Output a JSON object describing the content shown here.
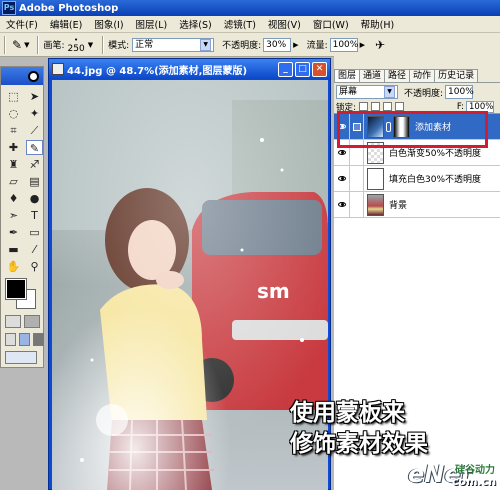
{
  "app": {
    "title": "Adobe Photoshop",
    "icon": "photoshop-icon"
  },
  "menu": [
    "文件(F)",
    "编辑(E)",
    "图象(I)",
    "图层(L)",
    "选择(S)",
    "滤镜(T)",
    "视图(V)",
    "窗口(W)",
    "帮助(H)"
  ],
  "options": {
    "brush_label": "画笔:",
    "brush_size": "250",
    "mode_label": "模式:",
    "mode_value": "正常",
    "opacity_label": "不透明度:",
    "opacity_value": "30%",
    "flow_label": "流量:",
    "flow_value": "100%"
  },
  "toolbox": {
    "tools": [
      "marquee-icon",
      "move-icon",
      "lasso-icon",
      "magic-wand-icon",
      "crop-icon",
      "slice-icon",
      "healing-brush-icon",
      "brush-icon",
      "clone-stamp-icon",
      "history-brush-icon",
      "eraser-icon",
      "gradient-icon",
      "blur-icon",
      "dodge-icon",
      "path-select-icon",
      "type-icon",
      "pen-icon",
      "shape-icon",
      "notes-icon",
      "eyedropper-icon",
      "hand-icon",
      "zoom-icon"
    ],
    "active_tool": "brush-icon",
    "foreground_color": "#000000",
    "background_color": "#ffffff"
  },
  "document": {
    "title": "44.jpg @ 48.7%(添加素材,图层蒙版)"
  },
  "layers_panel": {
    "tabs": [
      "图层",
      "通道",
      "路径",
      "动作",
      "历史记录"
    ],
    "active_tab": "图层",
    "blend_mode": "屏幕",
    "opacity_label": "不透明度:",
    "opacity_value": "100%",
    "lock_label": "锁定:",
    "fill_label": "F:",
    "fill_value": "100%",
    "layers": [
      {
        "name": "添加素材",
        "selected": true,
        "has_mask": true
      },
      {
        "name": "白色渐变50%不透明度",
        "selected": false,
        "has_mask": false
      },
      {
        "name": "填充白色30%不透明度",
        "selected": false,
        "has_mask": false
      },
      {
        "name": "背景",
        "selected": false,
        "has_mask": false
      }
    ]
  },
  "caption": {
    "line1": "使用蒙板来",
    "line2": "修饰素材效果"
  },
  "watermark": {
    "brand": "eNet",
    "sub": "硅谷动力",
    "url": "com.cn"
  },
  "colors": {
    "highlight": "#d01d2f",
    "selected_layer": "#316ac5",
    "title_bar": "#0a3fb5"
  }
}
